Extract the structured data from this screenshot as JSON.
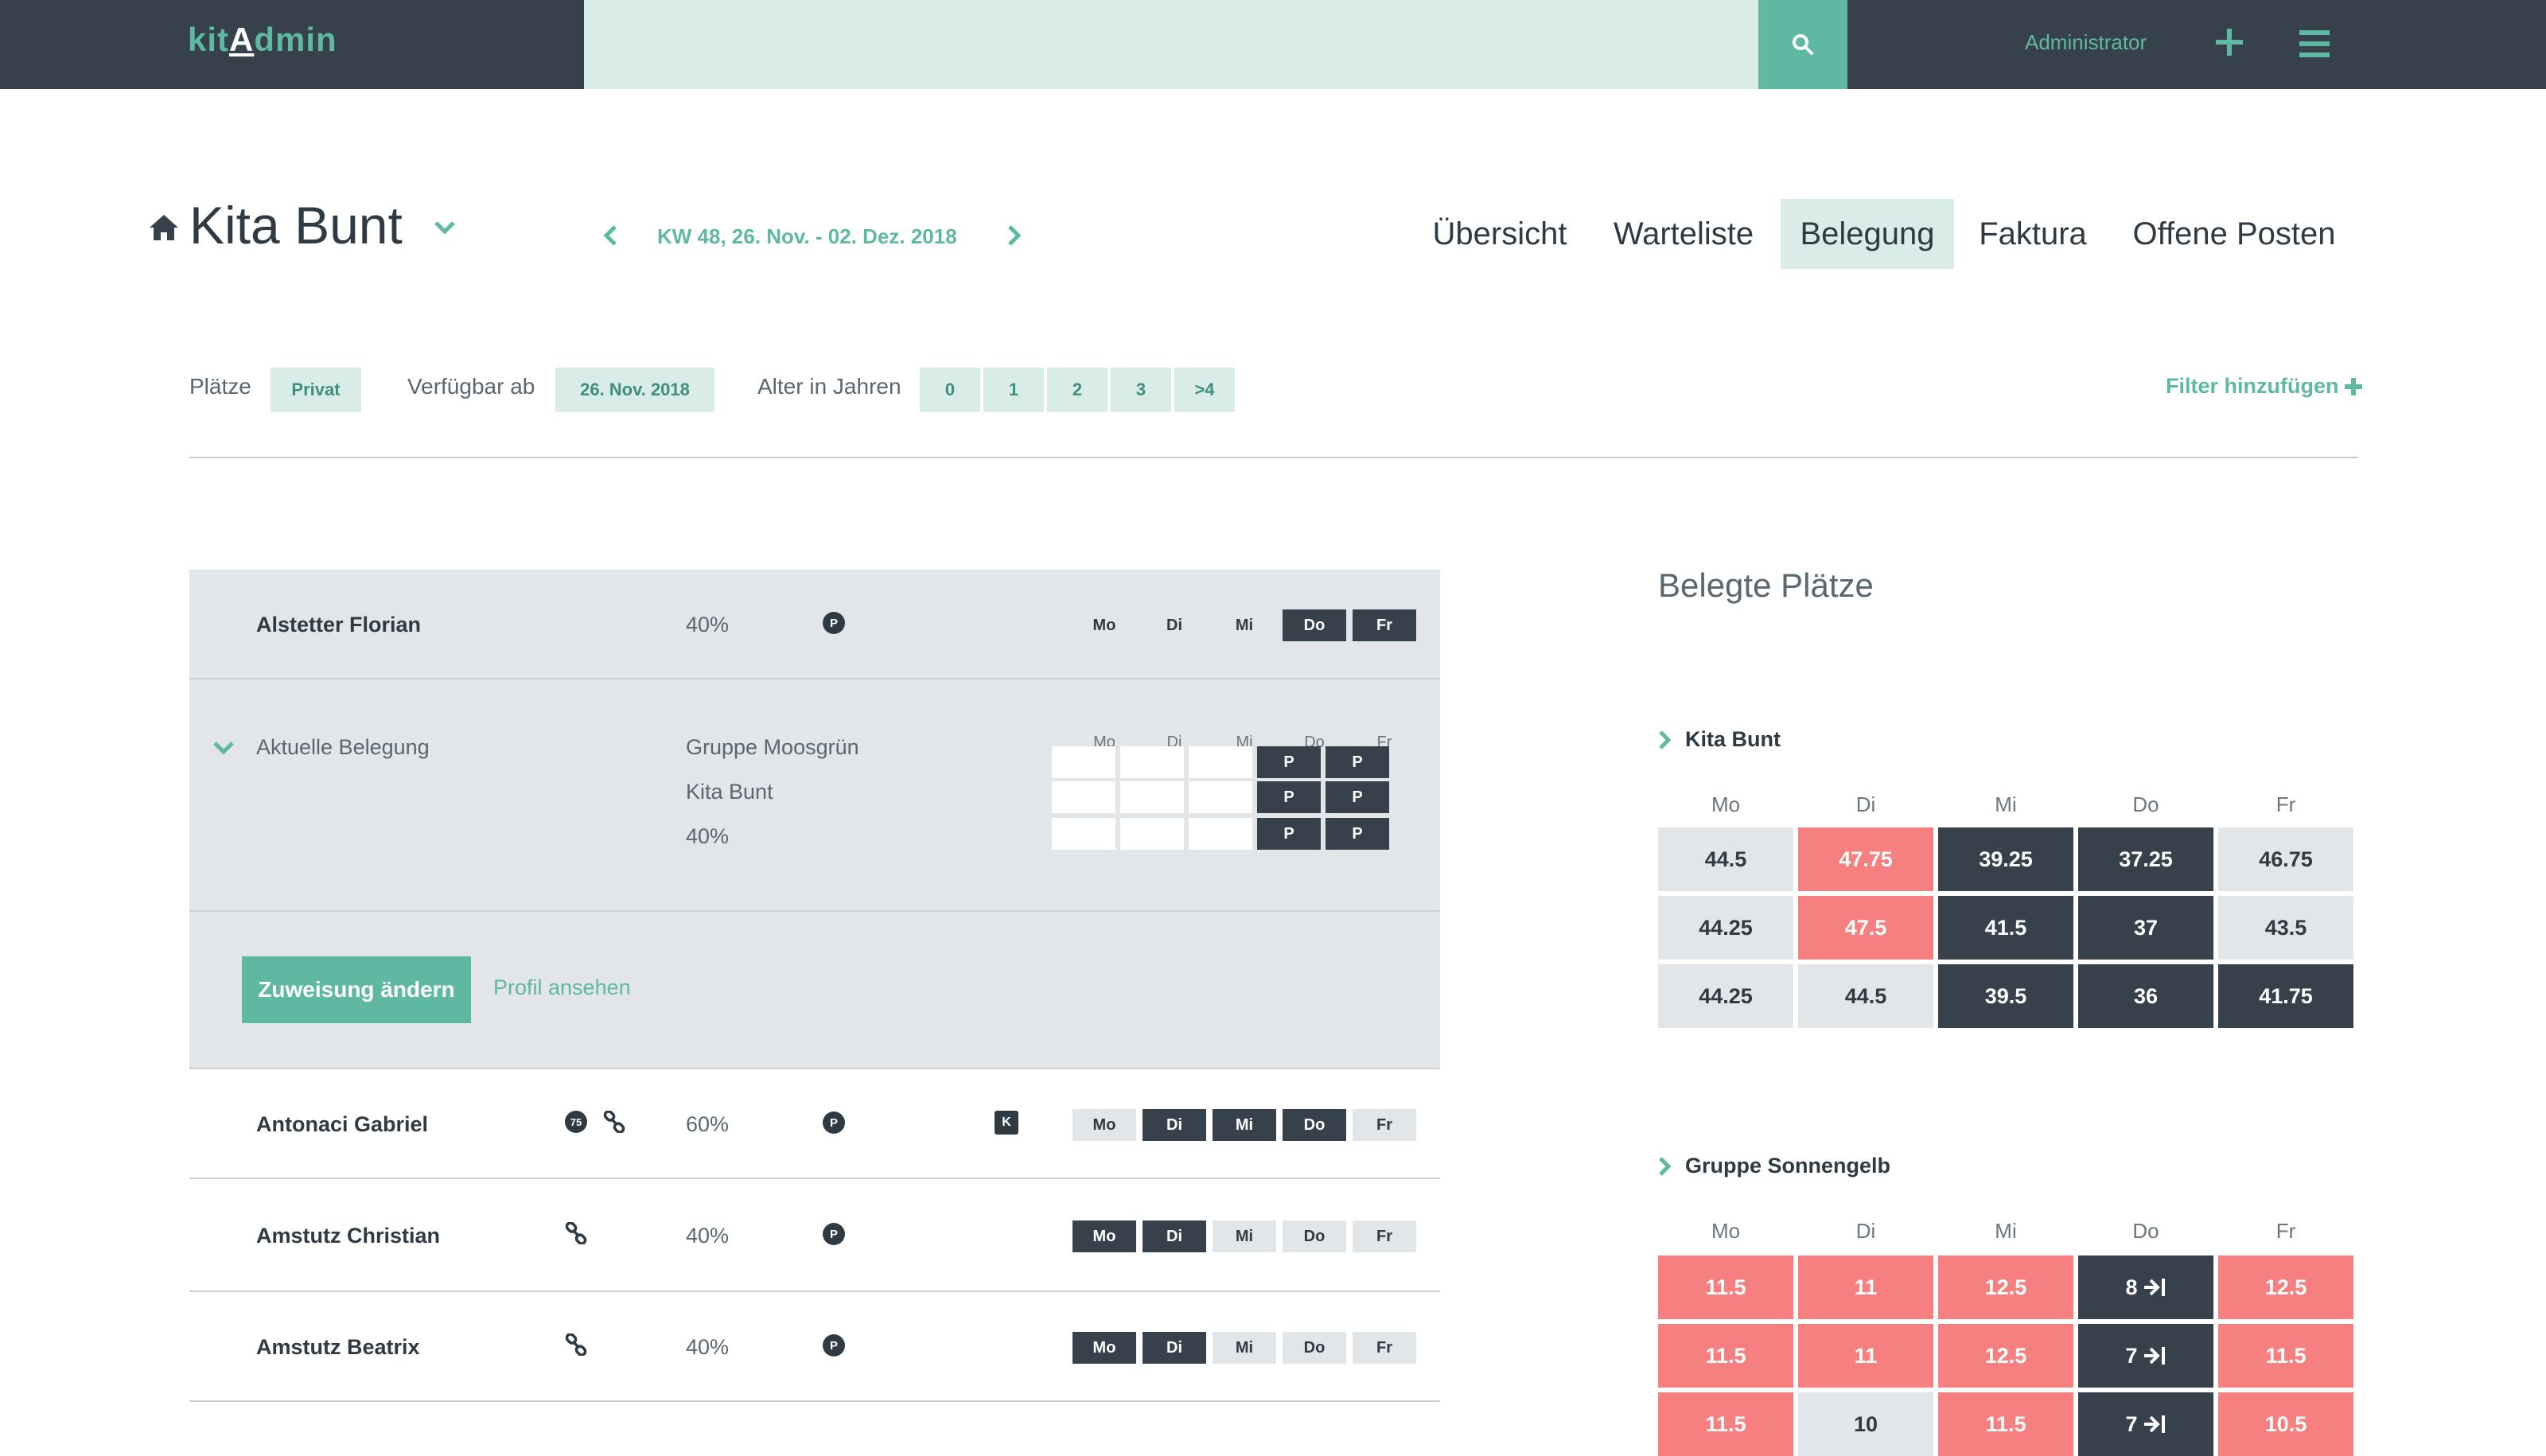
{
  "topbar": {
    "logo_prefix": "kit",
    "logo_a": "A",
    "logo_suffix": "dmin",
    "search_placeholder": "",
    "user": "Administrator"
  },
  "header": {
    "title": "Kita Bunt",
    "week": "KW 48, 26. Nov. - 02. Dez. 2018"
  },
  "tabs": [
    {
      "label": "Übersicht",
      "active": false
    },
    {
      "label": "Warteliste",
      "active": false
    },
    {
      "label": "Belegung",
      "active": true
    },
    {
      "label": "Faktura",
      "active": false
    },
    {
      "label": "Offene Posten",
      "active": false
    }
  ],
  "filters": {
    "places_label": "Plätze",
    "places_value": "Privat",
    "available_label": "Verfügbar ab",
    "available_value": "26. Nov. 2018",
    "age_label": "Alter in Jahren",
    "ages": [
      "0",
      "1",
      "2",
      "3",
      ">4"
    ],
    "add_filter": "Filter hinzufügen"
  },
  "days": [
    "Mo",
    "Di",
    "Mi",
    "Do",
    "Fr"
  ],
  "children": [
    {
      "name": "Alstetter Florian",
      "pct": "40%",
      "active_days": [
        false,
        false,
        false,
        true,
        true
      ]
    },
    {
      "name": "Antonaci Gabriel",
      "badge": "75",
      "pct": "60%",
      "k_badge": "K",
      "active_days": [
        false,
        true,
        true,
        true,
        false
      ]
    },
    {
      "name": "Amstutz Christian",
      "pct": "40%",
      "active_days": [
        true,
        true,
        false,
        false,
        false
      ]
    },
    {
      "name": "Amstutz Beatrix",
      "pct": "40%",
      "active_days": [
        true,
        true,
        false,
        false,
        false
      ]
    }
  ],
  "p_symbol": "P",
  "current_assignment": {
    "label": "Aktuelle Belegung",
    "group": "Gruppe Moosgrün",
    "kita": "Kita Bunt",
    "pct": "40%",
    "cell_label": "P"
  },
  "actions": {
    "change_assignment": "Zuweisung ändern",
    "view_profile": "Profil ansehen"
  },
  "side": {
    "title": "Belegte Plätze",
    "groups": [
      {
        "name": "Kita Bunt",
        "rows": [
          [
            {
              "v": "44.5",
              "c": "grey"
            },
            {
              "v": "47.75",
              "c": "red"
            },
            {
              "v": "39.25",
              "c": "dark"
            },
            {
              "v": "37.25",
              "c": "dark"
            },
            {
              "v": "46.75",
              "c": "grey"
            }
          ],
          [
            {
              "v": "44.25",
              "c": "grey"
            },
            {
              "v": "47.5",
              "c": "red"
            },
            {
              "v": "41.5",
              "c": "dark"
            },
            {
              "v": "37",
              "c": "dark"
            },
            {
              "v": "43.5",
              "c": "grey"
            }
          ],
          [
            {
              "v": "44.25",
              "c": "grey"
            },
            {
              "v": "44.5",
              "c": "grey"
            },
            {
              "v": "39.5",
              "c": "dark"
            },
            {
              "v": "36",
              "c": "dark"
            },
            {
              "v": "41.75",
              "c": "dark"
            }
          ]
        ]
      },
      {
        "name": "Gruppe Sonnengelb",
        "rows": [
          [
            {
              "v": "11.5",
              "c": "red"
            },
            {
              "v": "11",
              "c": "red"
            },
            {
              "v": "12.5",
              "c": "red"
            },
            {
              "v": "8",
              "c": "dark",
              "arrow": true
            },
            {
              "v": "12.5",
              "c": "red"
            }
          ],
          [
            {
              "v": "11.5",
              "c": "red"
            },
            {
              "v": "11",
              "c": "red"
            },
            {
              "v": "12.5",
              "c": "red"
            },
            {
              "v": "7",
              "c": "dark",
              "arrow": true
            },
            {
              "v": "11.5",
              "c": "red"
            }
          ],
          [
            {
              "v": "11.5",
              "c": "red"
            },
            {
              "v": "10",
              "c": "grey"
            },
            {
              "v": "11.5",
              "c": "red"
            },
            {
              "v": "7",
              "c": "dark",
              "arrow": true
            },
            {
              "v": "10.5",
              "c": "red"
            }
          ]
        ]
      }
    ]
  },
  "colors": {
    "topbar": "#36414b",
    "accent": "#5fb8a2",
    "accent_light": "#d9ece7",
    "dark": "#36414b",
    "red": "#f68080",
    "grey": "#e3e6e9"
  }
}
